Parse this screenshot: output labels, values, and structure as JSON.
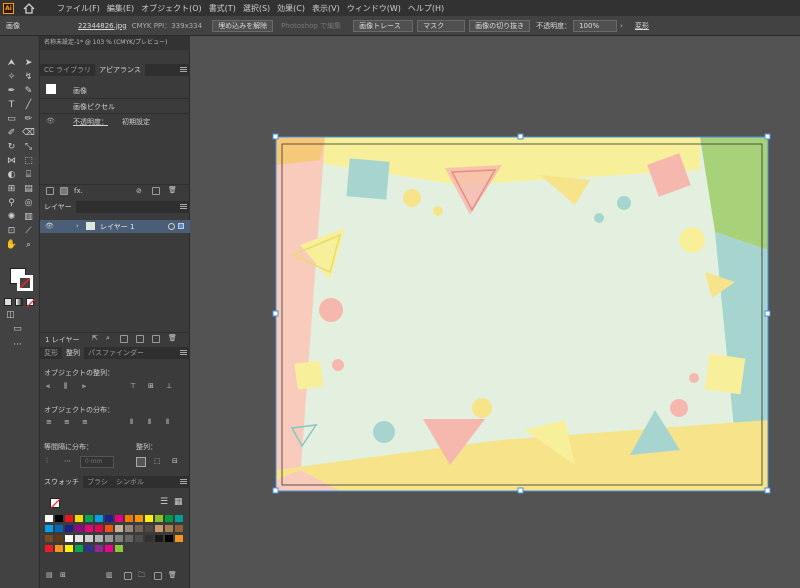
{
  "menubar": {
    "logo": "Ai",
    "items": [
      "ファイル(F)",
      "編集(E)",
      "オブジェクト(O)",
      "書式(T)",
      "選択(S)",
      "効果(C)",
      "表示(V)",
      "ウィンドウ(W)",
      "ヘルプ(H)"
    ]
  },
  "ctrlbar": {
    "kind": "画像",
    "filename": "22344826.jpg",
    "info": "CMYK PPI：339x334",
    "unembed": "埋め込みを解除",
    "photoshop": "Photoshop で編集",
    "trace": "画像トレース",
    "mask": "マスク",
    "crop": "画像の切り抜き",
    "opacity_label": "不透明度：",
    "opacity": "100%",
    "transform": "変形"
  },
  "doc_tab": "名称未設定-1* @ 103 % (CMYK/プレビュー)",
  "appearance": {
    "tabs": [
      "CC ライブラリ",
      "アピアランス"
    ],
    "title": "画像",
    "pixels": "画像ピクセル",
    "opacity_label": "不透明度：",
    "opacity_value": "初期設定"
  },
  "layers": {
    "tab": "レイヤー",
    "item": "レイヤー 1",
    "count": "1 レイヤー"
  },
  "align": {
    "tabs": [
      "変形",
      "整列",
      "パスファインダー"
    ],
    "align_objects": "オブジェクトの整列：",
    "distribute_objects": "オブジェクトの分布：",
    "distribute_spacing": "等間隔に分布：",
    "align_to": "整列：",
    "spacing_value": "0 mm"
  },
  "swatches": {
    "tabs": [
      "スウォッチ",
      "ブラシ",
      "シンボル"
    ]
  },
  "colors": {
    "accent_layer": "#4a8fd8",
    "fill_swatch": "#ffffff",
    "stroke_none": "#ff0000"
  }
}
